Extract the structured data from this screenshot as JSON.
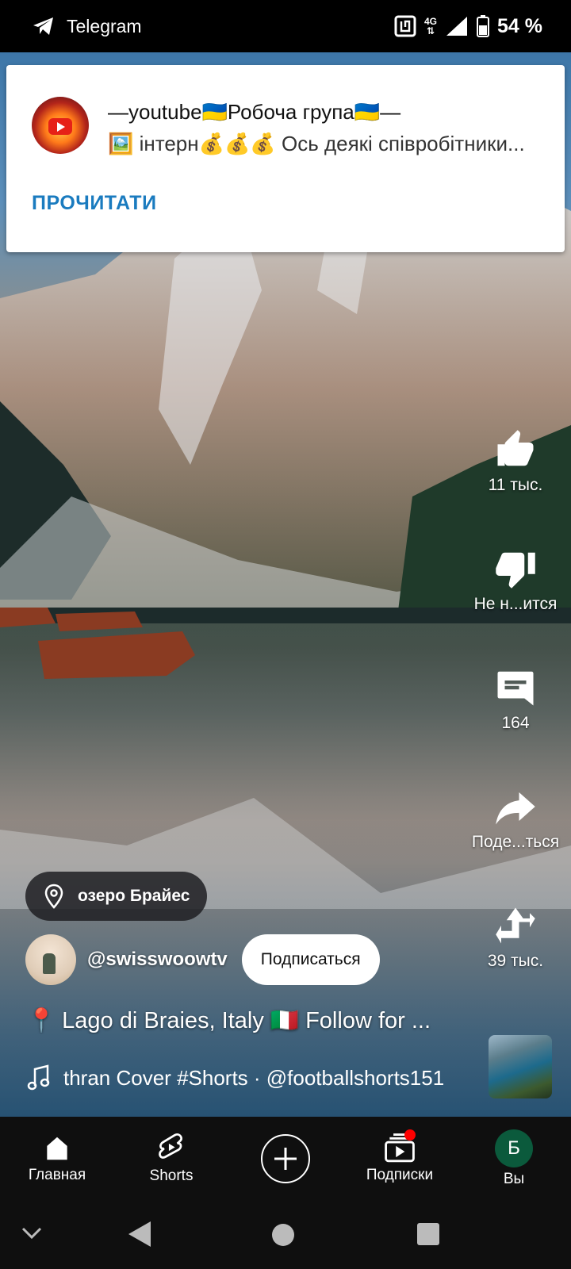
{
  "status_bar": {
    "app_name": "Telegram",
    "network": "4G",
    "battery_percent": "54 %"
  },
  "notification": {
    "title": "—youtube🇺🇦Робоча група🇺🇦—",
    "body": "🖼️ інтерн💰💰💰 Ось деякі співробітники...",
    "action": "ПРОЧИТАТИ"
  },
  "actions": {
    "like_count": "11 тыс.",
    "dislike_label": "Не н...ится",
    "comments_count": "164",
    "share_label": "Поде...ться",
    "remix_count": "39 тыс."
  },
  "video_info": {
    "location": "озеро Брайес",
    "channel_handle": "@swisswoowtv",
    "subscribe_label": "Подписаться",
    "caption": "📍 Lago di Braies, Italy 🇮🇹 Follow for ...",
    "music": "thran Cover #Shorts · @footballshorts151"
  },
  "bottom_nav": [
    {
      "label": "Главная",
      "icon": "home-icon"
    },
    {
      "label": "Shorts",
      "icon": "shorts-icon"
    },
    {
      "label": "",
      "icon": "create-icon"
    },
    {
      "label": "Подписки",
      "icon": "subscriptions-icon"
    },
    {
      "label": "Вы",
      "icon": "account-icon",
      "avatar_letter": "Б"
    }
  ],
  "colors": {
    "notification_action": "#1a7bbf",
    "subscribe_bg": "#ffffff",
    "nav_bg": "#0f0f0f",
    "badge": "#ff0000",
    "avatar_bg": "#0b5a3c"
  }
}
